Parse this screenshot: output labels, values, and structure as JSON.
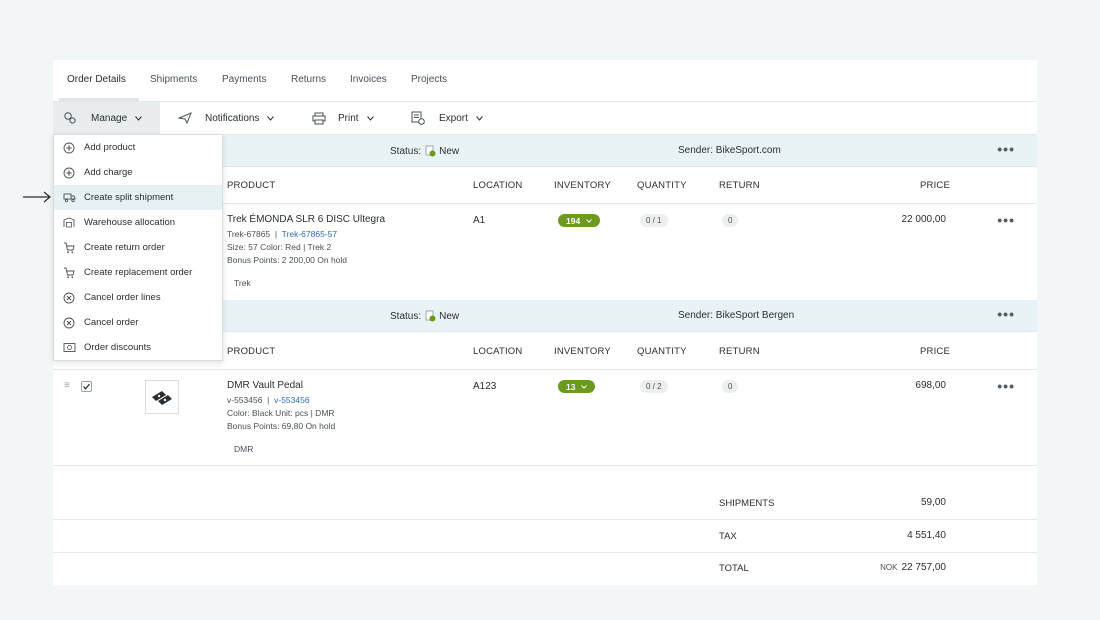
{
  "tabs": [
    {
      "label": "Order Details",
      "active": true
    },
    {
      "label": "Shipments"
    },
    {
      "label": "Payments"
    },
    {
      "label": "Returns"
    },
    {
      "label": "Invoices"
    },
    {
      "label": "Projects"
    }
  ],
  "toolbar": {
    "manage": "Manage",
    "notifications": "Notifications",
    "print": "Print",
    "export": "Export"
  },
  "dropdown": {
    "items": [
      {
        "label": "Add product",
        "icon": "plus-circle-icon"
      },
      {
        "label": "Add charge",
        "icon": "plus-circle-icon"
      },
      {
        "label": "Create split shipment",
        "icon": "split-shipment-icon",
        "highlighted": true
      },
      {
        "label": "Warehouse allocation",
        "icon": "warehouse-icon"
      },
      {
        "label": "Create return order",
        "icon": "cart-icon"
      },
      {
        "label": "Create replacement order",
        "icon": "cart-icon"
      },
      {
        "label": "Cancel order lines",
        "icon": "x-circle-icon"
      },
      {
        "label": "Cancel order",
        "icon": "x-circle-icon"
      },
      {
        "label": "Order discounts",
        "icon": "discount-icon"
      }
    ]
  },
  "columns": {
    "product": "PRODUCT",
    "location": "LOCATION",
    "inventory": "INVENTORY",
    "quantity": "QUANTITY",
    "return": "RETURN",
    "price": "PRICE"
  },
  "shipments": [
    {
      "status_label": "Status:",
      "status": "New",
      "sender": "Sender: BikeSport.com",
      "line": {
        "name": "Trek ÉMONDA SLR 6 DISC Ultegra",
        "sku": "Trek-67865",
        "sku_link": "Trek-67865-57",
        "attrs": "Size: 57   Color: Red   |   Trek 2",
        "bonus": "Bonus Points: 2 200,00  On hold",
        "tag": "Trek",
        "location": "A1",
        "inventory": "194",
        "quantity": "0 / 1",
        "return": "0",
        "price": "22 000,00"
      }
    },
    {
      "status_label": "Status:",
      "status": "New",
      "sender": "Sender: BikeSport Bergen",
      "line": {
        "name": "DMR Vault Pedal",
        "sku": "v-553456",
        "sku_link": "v-553456",
        "attrs": "Color: Black   Unit: pcs   |   DMR",
        "bonus": "Bonus Points: 69,80  On hold",
        "tag": "DMR",
        "location": "A123",
        "inventory": "13",
        "quantity": "0 / 2",
        "return": "0",
        "price": "698,00"
      }
    }
  ],
  "summary": {
    "shipments_label": "SHIPMENTS",
    "shipments_value": "59,00",
    "tax_label": "TAX",
    "tax_value": "4 551,40",
    "total_label": "TOTAL",
    "currency": "NOK",
    "total_value": "22 757,00"
  },
  "colors": {
    "accent_green": "#6b9a1f",
    "link_blue": "#2f6db0",
    "section_bg": "#e9f3f5"
  }
}
